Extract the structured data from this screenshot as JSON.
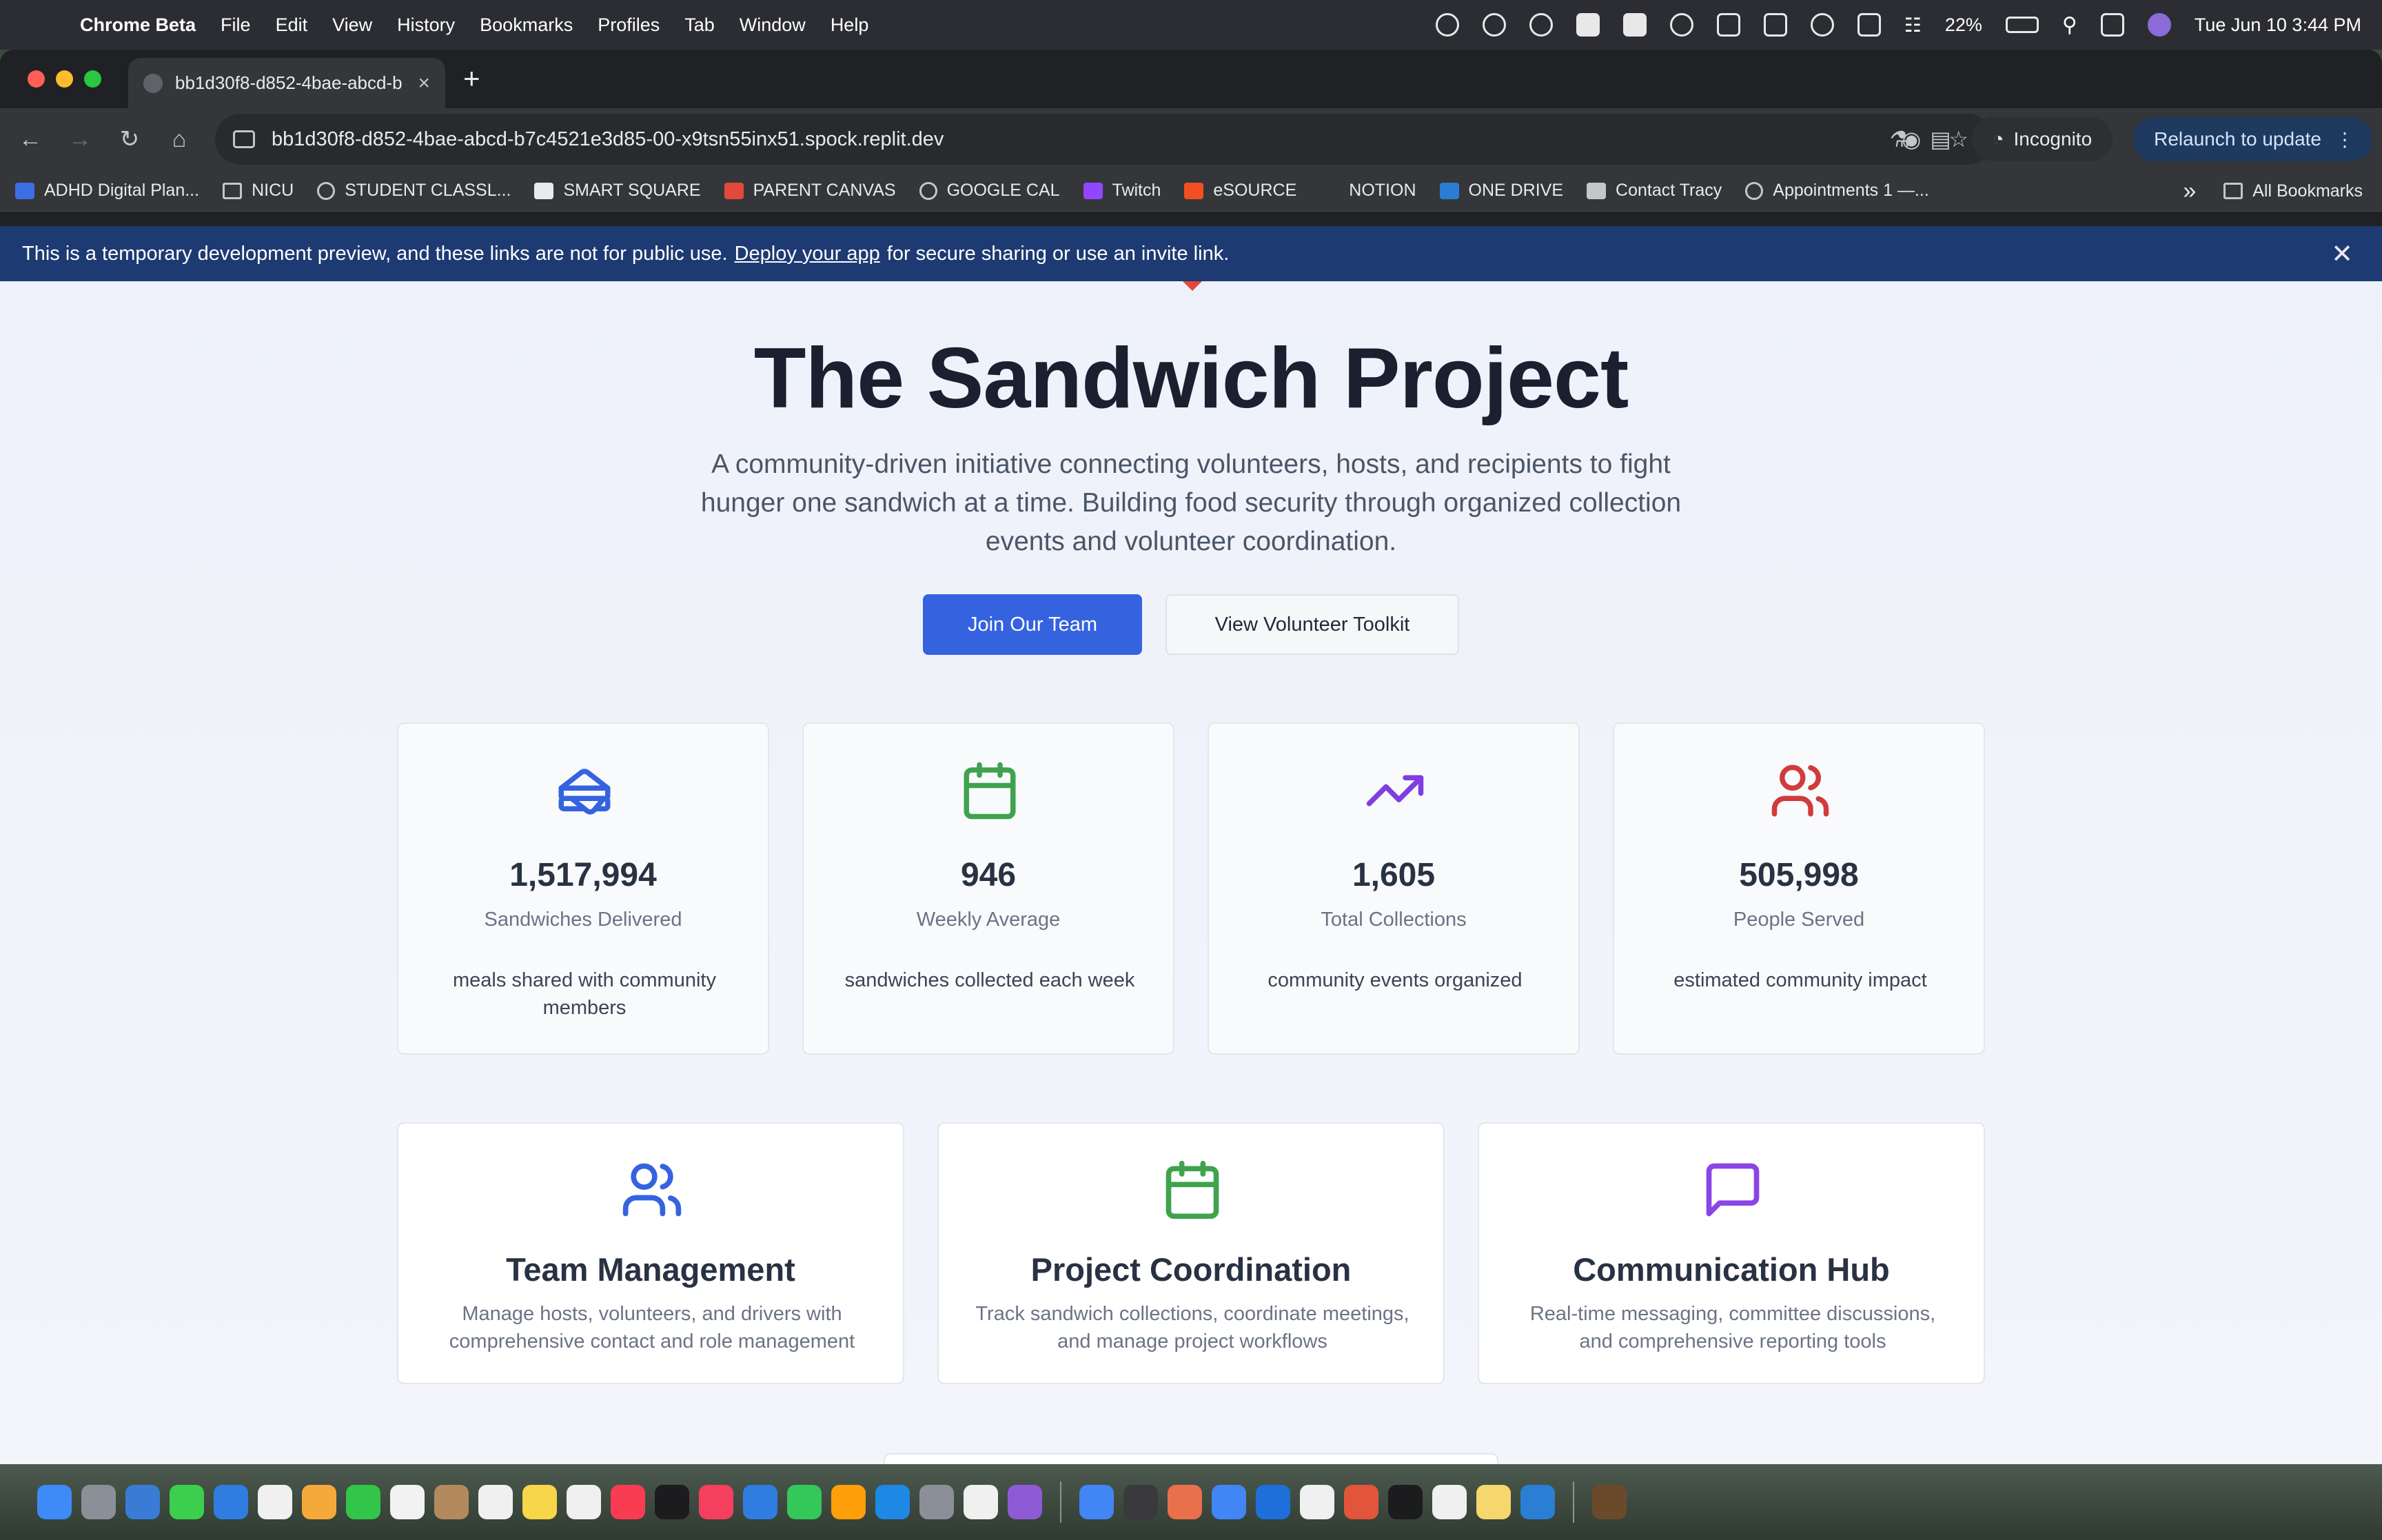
{
  "menubar": {
    "app_name": "Chrome Beta",
    "items": [
      "File",
      "Edit",
      "View",
      "History",
      "Bookmarks",
      "Profiles",
      "Tab",
      "Window",
      "Help"
    ],
    "battery": "22%",
    "clock": "Tue Jun 10  3:44 PM"
  },
  "browser": {
    "tab_title": "bb1d30f8-d852-4bae-abcd-b",
    "url": "bb1d30f8-d852-4bae-abcd-b7c4521e3d85-00-x9tsn55inx51.spock.replit.dev",
    "incognito_label": "Incognito",
    "relaunch_label": "Relaunch to update",
    "bookmarks": [
      {
        "label": "ADHD Digital Plan...",
        "icon": "app-icon",
        "color": "#3b6fe3"
      },
      {
        "label": "NICU",
        "icon": "folder-icon"
      },
      {
        "label": "STUDENT CLASSL...",
        "icon": "globe-icon"
      },
      {
        "label": "SMART SQUARE",
        "icon": "page-icon",
        "color": "#e8eaed"
      },
      {
        "label": "PARENT CANVAS",
        "icon": "canvas-icon",
        "color": "#e2483d"
      },
      {
        "label": "GOOGLE CAL",
        "icon": "globe-icon"
      },
      {
        "label": "Twitch",
        "icon": "twitch-icon",
        "color": "#9147ff"
      },
      {
        "label": "eSOURCE",
        "icon": "microsoft-icon",
        "color": "#f25022"
      },
      {
        "label": "NOTION",
        "icon": "list-icon"
      },
      {
        "label": "ONE DRIVE",
        "icon": "cloud-icon",
        "color": "#2b7cd3"
      },
      {
        "label": "Contact Tracy",
        "icon": "feather-icon",
        "color": "#c4c7c5"
      },
      {
        "label": "Appointments 1 —...",
        "icon": "globe-icon"
      }
    ],
    "more_bookmarks": "»",
    "all_bookmarks": "All Bookmarks"
  },
  "banner": {
    "text_before": "This is a temporary development preview, and these links are not for public use.",
    "link_text": "Deploy your app",
    "text_after": "for secure sharing or use an invite link."
  },
  "hero": {
    "title": "The Sandwich Project",
    "subtitle": "A community-driven initiative connecting volunteers, hosts, and recipients to fight hunger one sandwich at a time. Building food security through organized collection events and volunteer coordination.",
    "primary_cta": "Join Our Team",
    "secondary_cta": "View Volunteer Toolkit"
  },
  "stats": [
    {
      "value": "1,517,994",
      "label": "Sandwiches Delivered",
      "desc": "meals shared with community members",
      "icon": "sandwich-icon",
      "color": "#3563e0"
    },
    {
      "value": "946",
      "label": "Weekly Average",
      "desc": "sandwiches collected each week",
      "icon": "calendar-icon",
      "color": "#3fa34d"
    },
    {
      "value": "1,605",
      "label": "Total Collections",
      "desc": "community events organized",
      "icon": "trending-up-icon",
      "color": "#7e3ee0"
    },
    {
      "value": "505,998",
      "label": "People Served",
      "desc": "estimated community impact",
      "icon": "users-icon",
      "color": "#d13b3b"
    }
  ],
  "features": [
    {
      "title": "Team Management",
      "desc": "Manage hosts, volunteers, and drivers with comprehensive contact and role management",
      "icon": "users-icon",
      "color": "#3563e0"
    },
    {
      "title": "Project Coordination",
      "desc": "Track sandwich collections, coordinate meetings, and manage project workflows",
      "icon": "calendar-icon",
      "color": "#3fa34d"
    },
    {
      "title": "Communication Hub",
      "desc": "Real-time messaging, committee discussions, and comprehensive reporting tools",
      "icon": "message-square-icon",
      "color": "#8b45e6"
    }
  ],
  "dock": {
    "colors": [
      "#3d8bf7",
      "#8a8f98",
      "#3a7bd5",
      "#3ccf4e",
      "#2f7de1",
      "#f0f0f0",
      "#f6a93b",
      "#33c44a",
      "#f2f2f2",
      "#b38a5e",
      "#f0f0f0",
      "#f7d64a",
      "#f0f0f0",
      "#fa3c52",
      "#1c1c1e",
      "#f43f5e",
      "#2f7de1",
      "#34c759",
      "#ff9f0a",
      "#1e88e5",
      "#8a8f98",
      "#f0f0f0",
      "#8e5bd6",
      "#4285f4",
      "#3a3a3c",
      "#e8704a",
      "#4285f4",
      "#1e6fd9",
      "#f0f0f0",
      "#e2553b",
      "#1c1c1e",
      "#f0f0f0",
      "#f5d76e",
      "#2a7fd4",
      "#6b4a2b"
    ]
  }
}
